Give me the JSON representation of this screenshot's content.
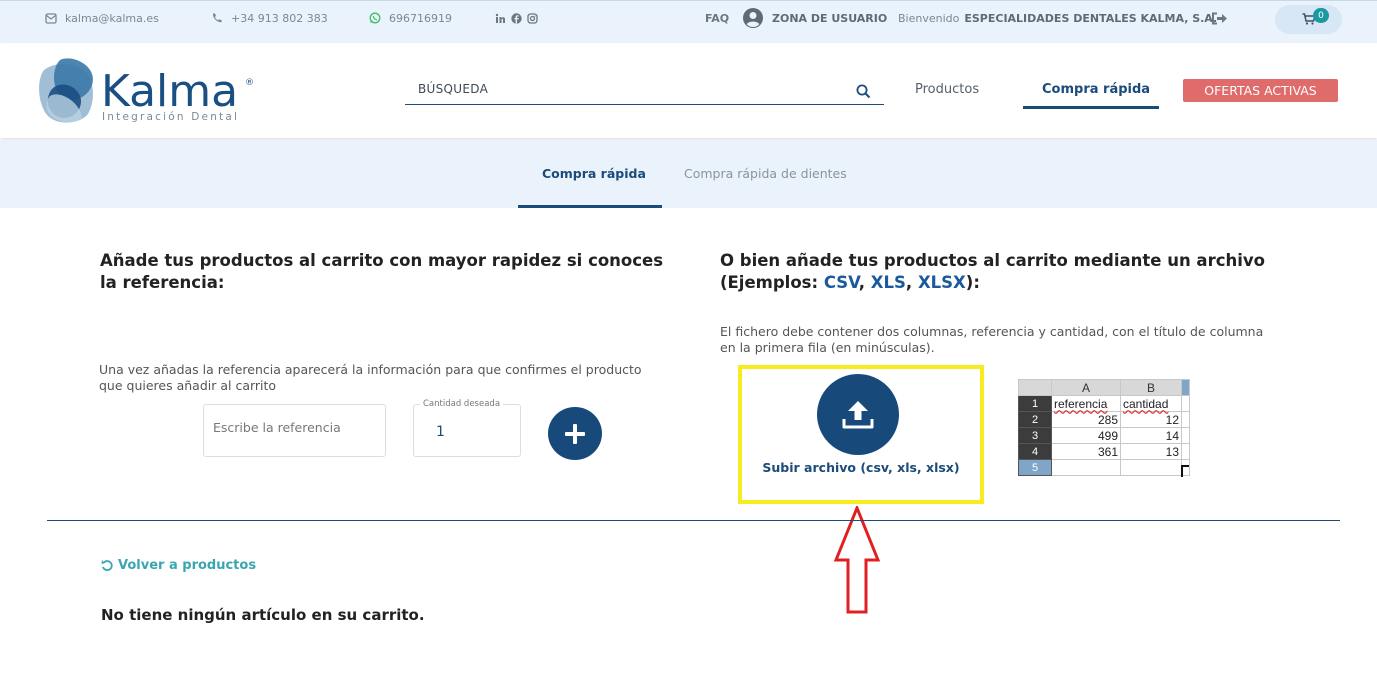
{
  "topbar": {
    "email": "kalma@kalma.es",
    "phone": "+34 913 802 383",
    "whatsapp": "696716919",
    "social_icons": [
      "linkedin-icon",
      "facebook-icon",
      "instagram-icon"
    ],
    "faq": "FAQ",
    "user_zone": "ZONA DE USUARIO",
    "welcome": "Bienvenido",
    "company": "ESPECIALIDADES DENTALES KALMA, S.A.",
    "cart_count": "0"
  },
  "header": {
    "logo_text": "Kalma",
    "logo_reg": "®",
    "logo_sub": "Integración Dental",
    "search_placeholder": "BÚSQUEDA",
    "nav": {
      "productos": "Productos",
      "compra_rapida": "Compra rápida"
    },
    "ofertas": "OFERTAS ACTIVAS"
  },
  "tabs": [
    "Compra rápida",
    "Compra rápida de dientes"
  ],
  "left": {
    "heading": "Añade tus productos al carrito con mayor rapidez si conoces la referencia:",
    "info": "Una vez añadas la referencia aparecerá la información para que confirmes el producto que quieres añadir al carrito",
    "ref_placeholder": "Escribe la referencia",
    "qty_label": "Cantidad deseada",
    "qty_value": "1"
  },
  "right": {
    "heading_prefix": "O bien añade tus productos al carrito mediante un archivo (Ejemplos: ",
    "ext1": "CSV",
    "sep1": ", ",
    "ext2": "XLS",
    "sep2": ", ",
    "ext3": "XLSX",
    "heading_suffix": "):",
    "info": "El fichero debe contener dos columnas, referencia y cantidad, con el título de columna en la primera fila (en minúsculas).",
    "upload_label": "Subir archivo (csv, xls, xlsx)"
  },
  "sheet": {
    "col_headers": [
      "A",
      "B"
    ],
    "rows": [
      {
        "n": "1",
        "a": "referencia",
        "b": "cantidad"
      },
      {
        "n": "2",
        "a": "285",
        "b": "12"
      },
      {
        "n": "3",
        "a": "499",
        "b": "14"
      },
      {
        "n": "4",
        "a": "361",
        "b": "13"
      },
      {
        "n": "5",
        "a": "",
        "b": ""
      }
    ]
  },
  "footer": {
    "back": "Volver a productos",
    "empty_cart": "No tiene ningún artículo en su carrito."
  },
  "colors": {
    "brand_blue": "#17497a",
    "teal": "#3aa6b0",
    "ofertas_red": "#df6b6b",
    "highlight_yellow": "#f6ec1f",
    "arrow_red": "#e02020"
  }
}
